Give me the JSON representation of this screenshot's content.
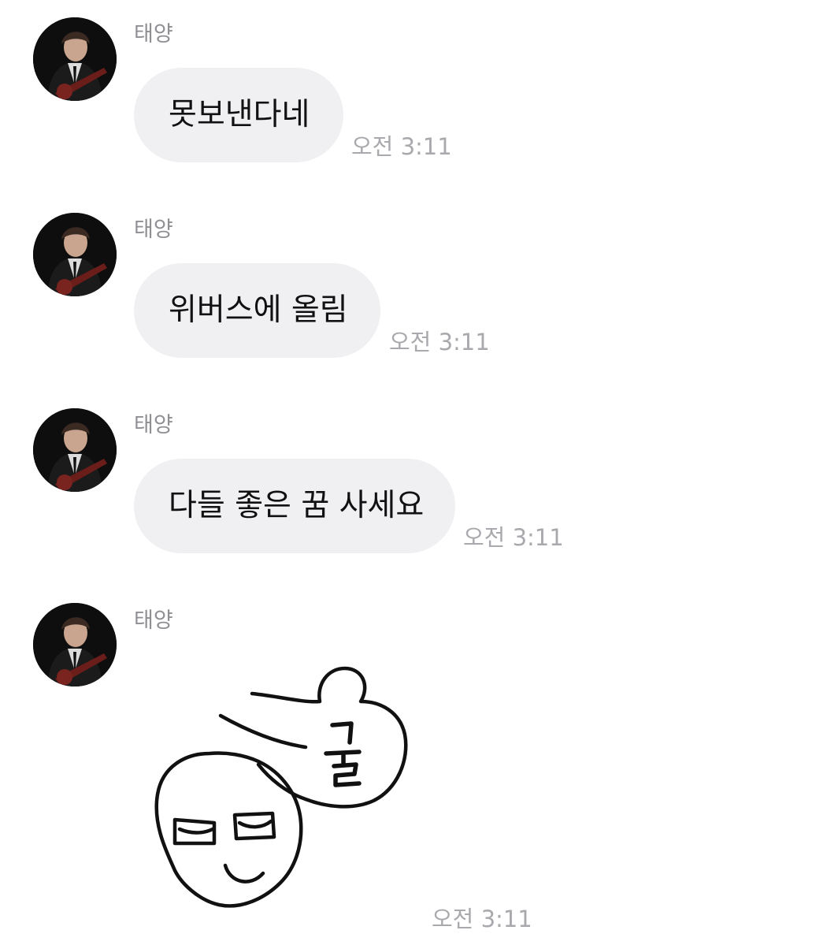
{
  "messages": [
    {
      "sender": "태양",
      "text": "못보낸다네",
      "time": "오전 3:11"
    },
    {
      "sender": "태양",
      "text": "위버스에 올림",
      "time": "오전 3:11"
    },
    {
      "sender": "태양",
      "text": "다들 좋은 꿈 사세요",
      "time": "오전 3:11"
    },
    {
      "sender": "태양",
      "sticker": {
        "icon": "thumbs-up-face-sticker",
        "text": "굳"
      },
      "time": "오전 3:11"
    }
  ],
  "colors": {
    "bubble_bg": "#f0f0f3",
    "sender_text": "#8e8e93",
    "time_text": "#a9a9ad",
    "message_text": "#111111"
  }
}
